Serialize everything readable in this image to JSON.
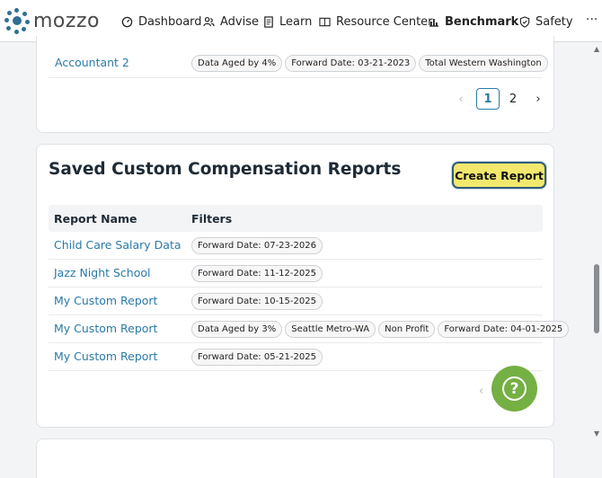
{
  "nav": {
    "logo": "mozzo",
    "items": [
      {
        "label": "Dashboard",
        "icon": "gauge-icon"
      },
      {
        "label": "Advise",
        "icon": "people-icon"
      },
      {
        "label": "Learn",
        "icon": "document-icon"
      },
      {
        "label": "Resource Center",
        "icon": "book-icon"
      },
      {
        "label": "Benchmark",
        "icon": "bar-chart-icon",
        "active": true
      },
      {
        "label": "Safety",
        "icon": "shield-icon"
      }
    ],
    "more": "···"
  },
  "top_card": {
    "row_name": "Accountant 2",
    "filters": [
      "Data Aged by 4%",
      "Forward Date: 03-21-2023",
      "Total Western Washington"
    ],
    "pager": {
      "prev": "‹",
      "pages": [
        "1",
        "2"
      ],
      "next": "›",
      "current": "1"
    }
  },
  "saved_reports": {
    "title": "Saved Custom Compensation Reports",
    "create_label": "Create Report",
    "columns": [
      "Report Name",
      "Filters"
    ],
    "rows": [
      {
        "name": "Child Care Salary Data",
        "filters": [
          "Forward Date: 07-23-2026"
        ]
      },
      {
        "name": "Jazz Night School",
        "filters": [
          "Forward Date: 11-12-2025"
        ]
      },
      {
        "name": "My Custom Report",
        "filters": [
          "Forward Date: 10-15-2025"
        ]
      },
      {
        "name": "My Custom Report",
        "filters": [
          "Data Aged by 3%",
          "Seattle Metro-WA",
          "Non Profit",
          "Forward Date: 04-01-2025"
        ]
      },
      {
        "name": "My Custom Report",
        "filters": [
          "Forward Date: 05-21-2025"
        ]
      }
    ],
    "pager_prev": "‹"
  },
  "help": {
    "glyph": "?"
  },
  "colors": {
    "accent_link": "#2a7aa7",
    "button_bg": "#f2e86d",
    "help_bg": "#74b043"
  }
}
